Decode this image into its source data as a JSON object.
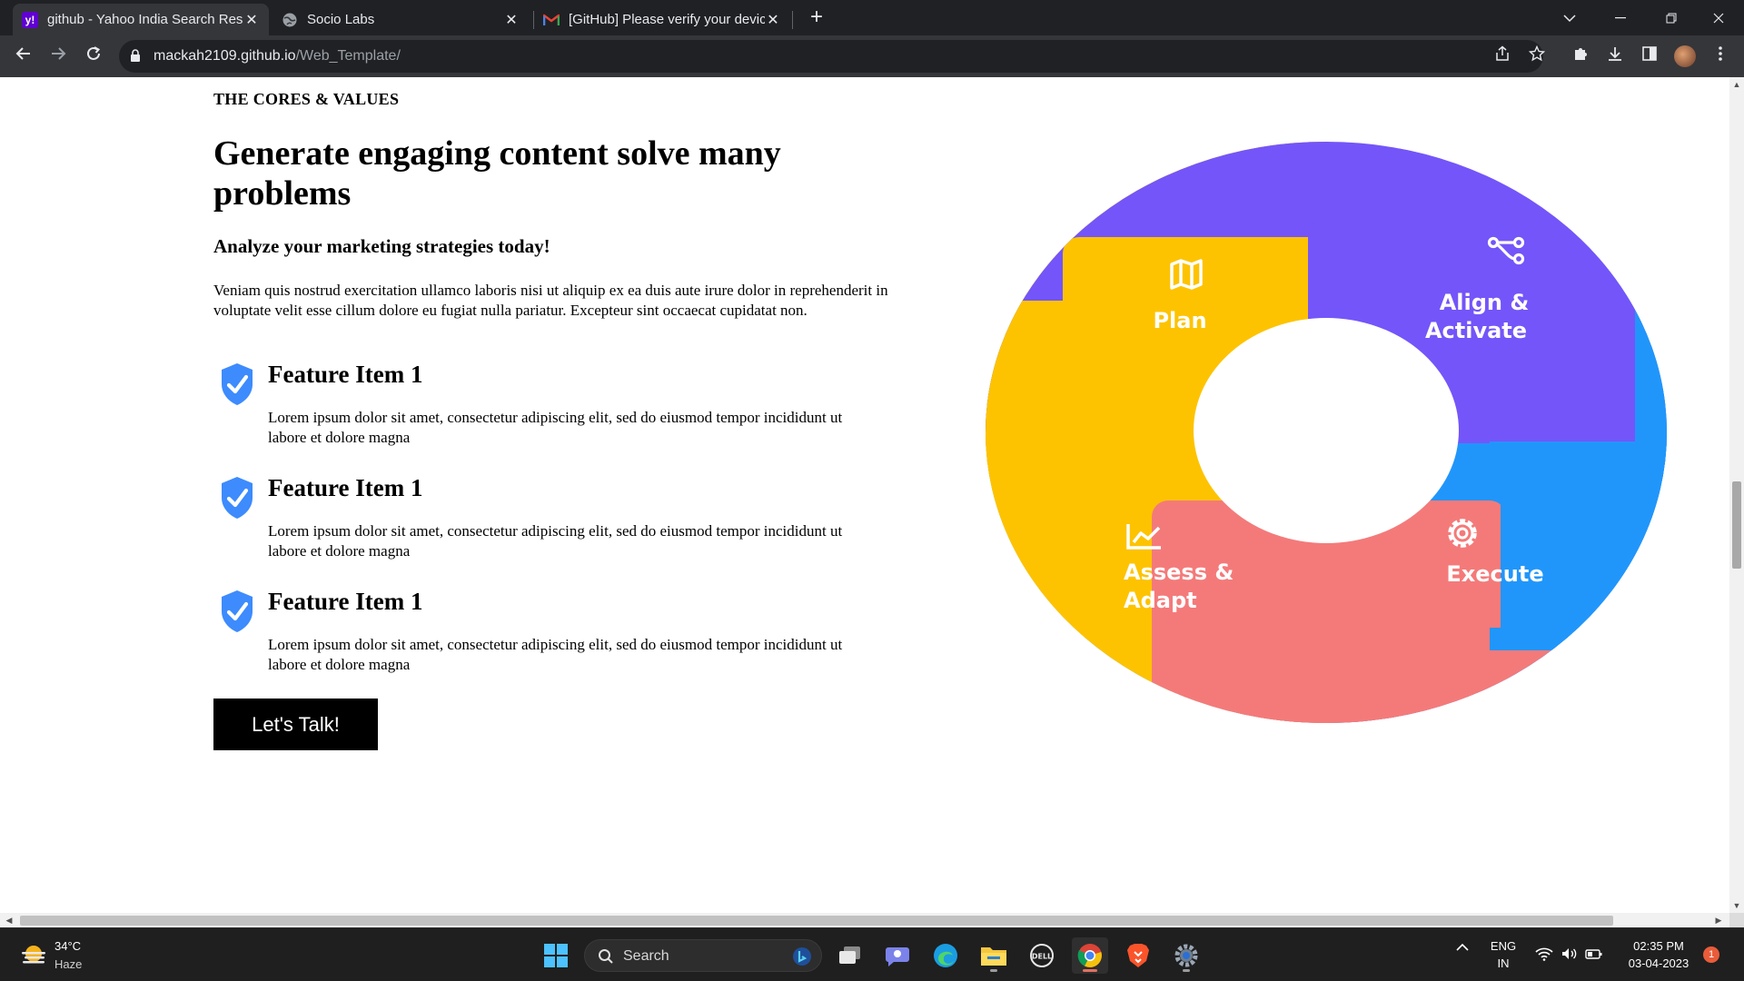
{
  "browser": {
    "tabs": [
      {
        "title": "github - Yahoo India Search Resu",
        "favicon": "yahoo-icon",
        "active": true
      },
      {
        "title": "Socio Labs",
        "favicon": "globe-icon",
        "active": false
      },
      {
        "title": "[GitHub] Please verify your devic",
        "favicon": "gmail-icon",
        "active": false
      }
    ],
    "url_host": "mackah2109.github.io",
    "url_path": "/Web_Template/"
  },
  "content": {
    "eyebrow": "THE CORES & VALUES",
    "headline": "Generate engaging content solve many problems",
    "subheadline": "Analyze your marketing strategies today!",
    "intro": "Veniam quis nostrud exercitation ullamco laboris nisi ut aliquip ex ea duis aute irure dolor in reprehenderit in voluptate velit esse cillum dolore eu fugiat nulla pariatur. Excepteur sint occaecat cupidatat non.",
    "features": [
      {
        "title": "Feature Item 1",
        "description": "Lorem ipsum dolor sit amet, consectetur adipiscing elit, sed do eiusmod tempor incididunt ut labore et dolore magna"
      },
      {
        "title": "Feature Item 1",
        "description": "Lorem ipsum dolor sit amet, consectetur adipiscing elit, sed do eiusmod tempor incididunt ut labore et dolore magna"
      },
      {
        "title": "Feature Item 1",
        "description": "Lorem ipsum dolor sit amet, consectetur adipiscing elit, sed do eiusmod tempor incididunt ut labore et dolore magna"
      }
    ],
    "cta_label": "Let's Talk!"
  },
  "diagram": {
    "segments": {
      "plan": {
        "line1": "Plan",
        "color": "#FDC300",
        "icon": "map-icon"
      },
      "align": {
        "line1": "Align &",
        "line2": "Activate",
        "color": "#7455F9",
        "icon": "share-nodes-icon"
      },
      "execute": {
        "line1": "Execute",
        "color": "#2196FA",
        "icon": "gear-icon"
      },
      "assess": {
        "line1": "Assess &",
        "line2": "Adapt",
        "color": "#F47A7A",
        "icon": "line-chart-icon"
      }
    }
  },
  "taskbar": {
    "weather_temp": "34°C",
    "weather_condition": "Haze",
    "search_label": "Search",
    "lang_line1": "ENG",
    "lang_line2": "IN",
    "time": "02:35 PM",
    "date": "03-04-2023",
    "notification_count": "1"
  },
  "colors": {
    "check_blue": "#3D8BFD",
    "cta_background": "#000000",
    "chrome_dark": "#202124"
  }
}
